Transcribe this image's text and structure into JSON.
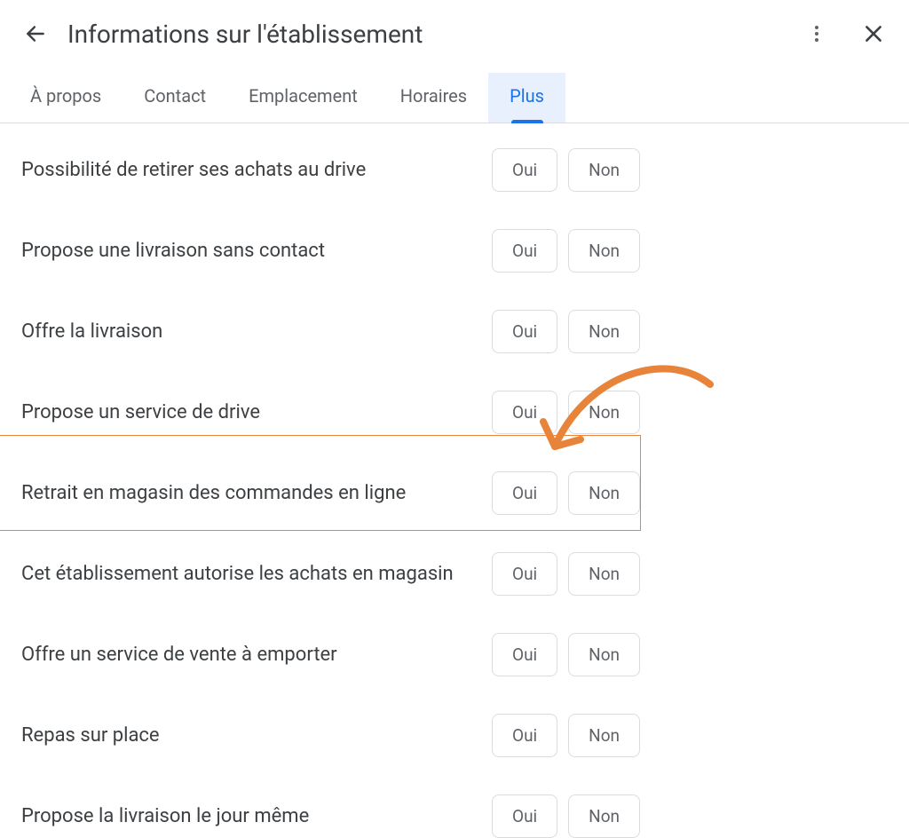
{
  "header": {
    "title": "Informations sur l'établissement"
  },
  "tabs": {
    "about": "À propos",
    "contact": "Contact",
    "location": "Emplacement",
    "hours": "Horaires",
    "more": "Plus"
  },
  "buttons": {
    "yes": "Oui",
    "no": "Non"
  },
  "options": [
    {
      "label": "Possibilité de retirer ses achats au drive"
    },
    {
      "label": "Propose une livraison sans contact"
    },
    {
      "label": "Offre la livraison"
    },
    {
      "label": "Propose un service de drive"
    },
    {
      "label": "Retrait en magasin des commandes en ligne"
    },
    {
      "label": "Cet établissement autorise les achats en magasin"
    },
    {
      "label": "Offre un service de vente à emporter"
    },
    {
      "label": "Repas sur place"
    },
    {
      "label": "Propose la livraison le jour même"
    }
  ],
  "annotation": {
    "highlight_color": "#e8833a",
    "highlighted_index": 4
  }
}
